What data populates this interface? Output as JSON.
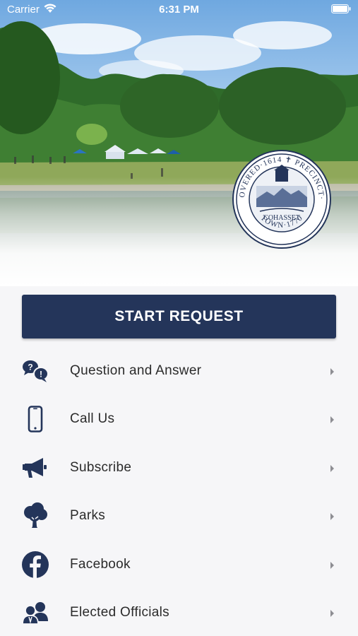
{
  "status_bar": {
    "carrier": "Carrier",
    "time": "6:31 PM"
  },
  "hero": {
    "seal_top_text": "DISCOVERED 1614 PRECINCT 1717",
    "seal_center_text": "COHASSET",
    "seal_bottom_text": "TOWN 1770"
  },
  "start_button": {
    "label": "START REQUEST"
  },
  "menu": {
    "items": [
      {
        "label": "Question and Answer",
        "icon": "question-answer-icon"
      },
      {
        "label": "Call Us",
        "icon": "phone-icon"
      },
      {
        "label": "Subscribe",
        "icon": "megaphone-icon"
      },
      {
        "label": "Parks",
        "icon": "tree-icon"
      },
      {
        "label": "Facebook",
        "icon": "facebook-icon"
      },
      {
        "label": "Elected Officials",
        "icon": "officials-icon"
      }
    ]
  },
  "colors": {
    "primary": "#24355a",
    "text": "#2b2b2b",
    "chevron": "#8e8e93",
    "background": "#f6f6f8"
  }
}
